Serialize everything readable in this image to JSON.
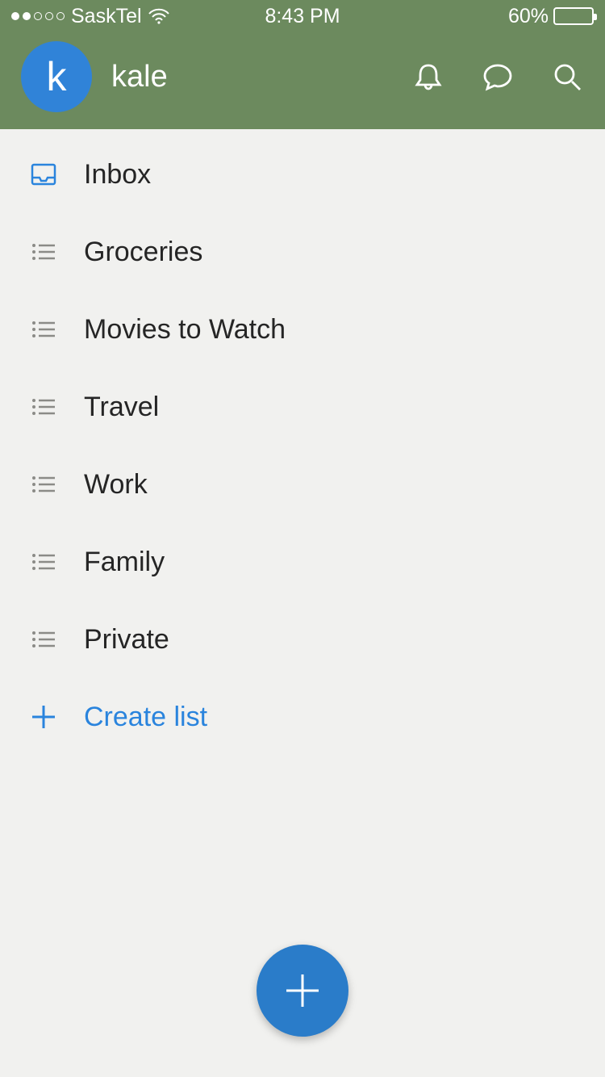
{
  "status_bar": {
    "signal_dots_filled": 2,
    "signal_dots_total": 5,
    "carrier": "SaskTel",
    "time": "8:43 PM",
    "battery_percent_text": "60%",
    "battery_fill_percent": 60
  },
  "header": {
    "avatar_initial": "k",
    "username": "kale"
  },
  "lists": [
    {
      "label": "Inbox",
      "icon": "inbox",
      "accent": false
    },
    {
      "label": "Groceries",
      "icon": "list",
      "accent": false
    },
    {
      "label": "Movies to Watch",
      "icon": "list",
      "accent": false
    },
    {
      "label": "Travel",
      "icon": "list",
      "accent": false
    },
    {
      "label": "Work",
      "icon": "list",
      "accent": false
    },
    {
      "label": "Family",
      "icon": "list",
      "accent": false
    },
    {
      "label": "Private",
      "icon": "list",
      "accent": false
    }
  ],
  "create_list": {
    "label": "Create list"
  },
  "colors": {
    "header_bg": "#6c8a5e",
    "accent_blue": "#2a84dd",
    "fab_blue": "#2a7cc9",
    "avatar_blue": "#3083d8"
  }
}
